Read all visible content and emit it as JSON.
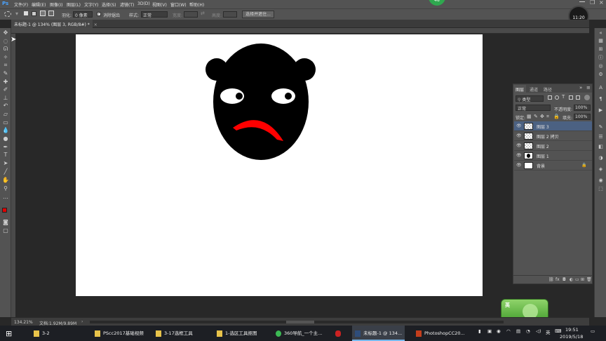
{
  "menu": {
    "logo": "Ps",
    "items": [
      "文件(F)",
      "编辑(E)",
      "图像(I)",
      "图层(L)",
      "文字(Y)",
      "选择(S)",
      "滤镜(T)",
      "3D(D)",
      "视图(V)",
      "窗口(W)",
      "帮助(H)"
    ]
  },
  "options": {
    "feather_label": "羽化:",
    "feather_value": "0 像素",
    "antialias_label": "消除锯齿",
    "style_label": "样式:",
    "style_value": "正常",
    "width_label": "宽度:",
    "height_label": "高度:",
    "select_mask_button": "选择并遮住..."
  },
  "document_tab": {
    "title": "未标题-1 @ 134% (图层 3, RGB/8#) *",
    "close": "×"
  },
  "status": {
    "zoom": "134.21%",
    "doc_size": "文档:1.92M/9.89M"
  },
  "layers_panel": {
    "tabs": [
      "图层",
      "通道",
      "路径"
    ],
    "filter_label": "类型",
    "blend_mode": "正常",
    "opacity_label": "不透明度:",
    "opacity_value": "100%",
    "lock_label": "锁定:",
    "fill_label": "填充:",
    "fill_value": "100%",
    "layers": [
      {
        "name": "图层 3",
        "selected": true
      },
      {
        "name": "图层 2 拷贝",
        "selected": false
      },
      {
        "name": "图层 2",
        "selected": false
      },
      {
        "name": "图层 1",
        "selected": false
      },
      {
        "name": "背景",
        "selected": false
      }
    ]
  },
  "overlay": {
    "badge": "48",
    "clock_bubble": "11:20",
    "ime_label": "英"
  },
  "taskbar": {
    "items": [
      {
        "label": "3-2",
        "icon_color": "#e8c34a"
      },
      {
        "label": "PScc2017基础视频",
        "icon_color": "#e8c34a"
      },
      {
        "label": "3-17选框工具",
        "icon_color": "#e8c34a"
      },
      {
        "label": "1-选区工具抠图",
        "icon_color": "#e8c34a"
      },
      {
        "label": "360导航_一个主...",
        "icon_color": "#3cba54"
      },
      {
        "label": "",
        "icon_color": "#cc2222"
      },
      {
        "label": "未标题-1 @ 134...",
        "icon_color": "#2f4d7a",
        "active": true
      },
      {
        "label": "PhotoshopCC20...",
        "icon_color": "#c43e1c"
      }
    ],
    "tray": {
      "ime": "英",
      "time": "19:51",
      "date": "2019/5/18"
    }
  },
  "colors": {
    "foreground": "#e00000",
    "background": "#ffffff",
    "accent": "#4b6182"
  }
}
